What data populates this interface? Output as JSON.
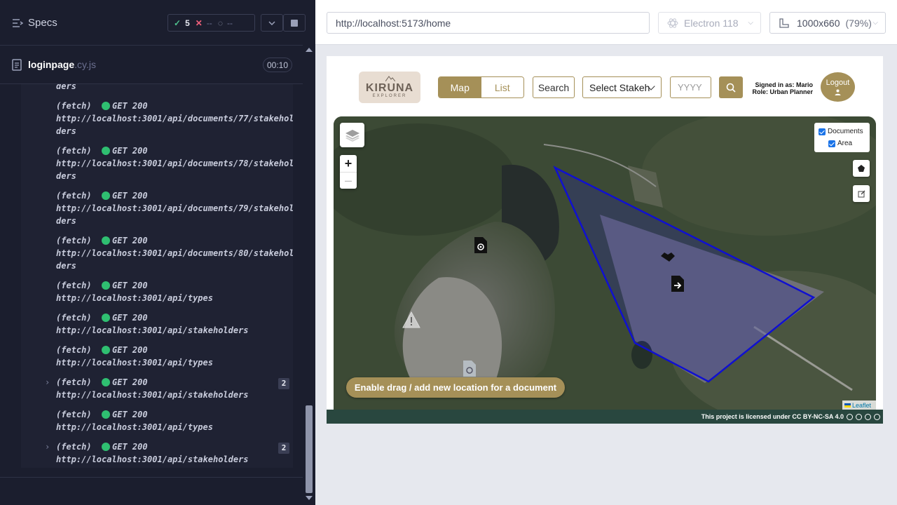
{
  "cypress": {
    "specs_title": "Specs",
    "stats": {
      "passed": "5",
      "failed": "--",
      "pending": "--"
    },
    "spec_file": {
      "name": "loginpage",
      "ext": ".cy.js",
      "duration": "00:10"
    },
    "log": [
      {
        "lines": [
          "ders"
        ],
        "partial": true
      },
      {
        "tag": "(fetch)",
        "method": "GET 200",
        "lines": [
          "http://localhost:3001/api/documents/77/stakehol",
          "ders"
        ]
      },
      {
        "tag": "(fetch)",
        "method": "GET 200",
        "lines": [
          "http://localhost:3001/api/documents/78/stakehol",
          "ders"
        ]
      },
      {
        "tag": "(fetch)",
        "method": "GET 200",
        "lines": [
          "http://localhost:3001/api/documents/79/stakehol",
          "ders"
        ]
      },
      {
        "tag": "(fetch)",
        "method": "GET 200",
        "lines": [
          "http://localhost:3001/api/documents/80/stakehol",
          "ders"
        ]
      },
      {
        "tag": "(fetch)",
        "method": "GET 200",
        "lines": [
          "http://localhost:3001/api/types"
        ]
      },
      {
        "tag": "(fetch)",
        "method": "GET 200",
        "lines": [
          "http://localhost:3001/api/stakeholders"
        ]
      },
      {
        "tag": "(fetch)",
        "method": "GET 200",
        "lines": [
          "http://localhost:3001/api/types"
        ]
      },
      {
        "tag": "(fetch)",
        "method": "GET 200",
        "lines": [
          "http://localhost:3001/api/stakeholders"
        ],
        "count": "2",
        "expandable": true
      },
      {
        "tag": "(fetch)",
        "method": "GET 200",
        "lines": [
          "http://localhost:3001/api/types"
        ]
      },
      {
        "tag": "(fetch)",
        "method": "GET 200",
        "lines": [
          "http://localhost:3001/api/stakeholders"
        ],
        "count": "2",
        "expandable": true
      }
    ]
  },
  "browser": {
    "url": "http://localhost:5173/home",
    "browser_name": "Electron 118",
    "viewport": "1000x660",
    "zoom": "(79%)"
  },
  "app": {
    "logo": {
      "main": "KIRUNA",
      "sub": "EXPLORER"
    },
    "view_toggle": {
      "map": "Map",
      "list": "List"
    },
    "search_label": "Search",
    "stakeholder_select": "Select Stakeh",
    "year_placeholder": "YYYY",
    "signed_in": "Signed in as: Mario",
    "role": "Role: Urban Planner",
    "logout": "Logout",
    "legend": {
      "documents": "Documents",
      "area": "Area"
    },
    "drag_button": "Enable drag / add new location for a document",
    "leaflet": "Leaflet",
    "footer": "This project is licensed under CC BY-NC-SA 4.0",
    "colors": {
      "accent": "#a59058",
      "footer": "#29473f",
      "area_stroke": "#1010d0"
    }
  }
}
